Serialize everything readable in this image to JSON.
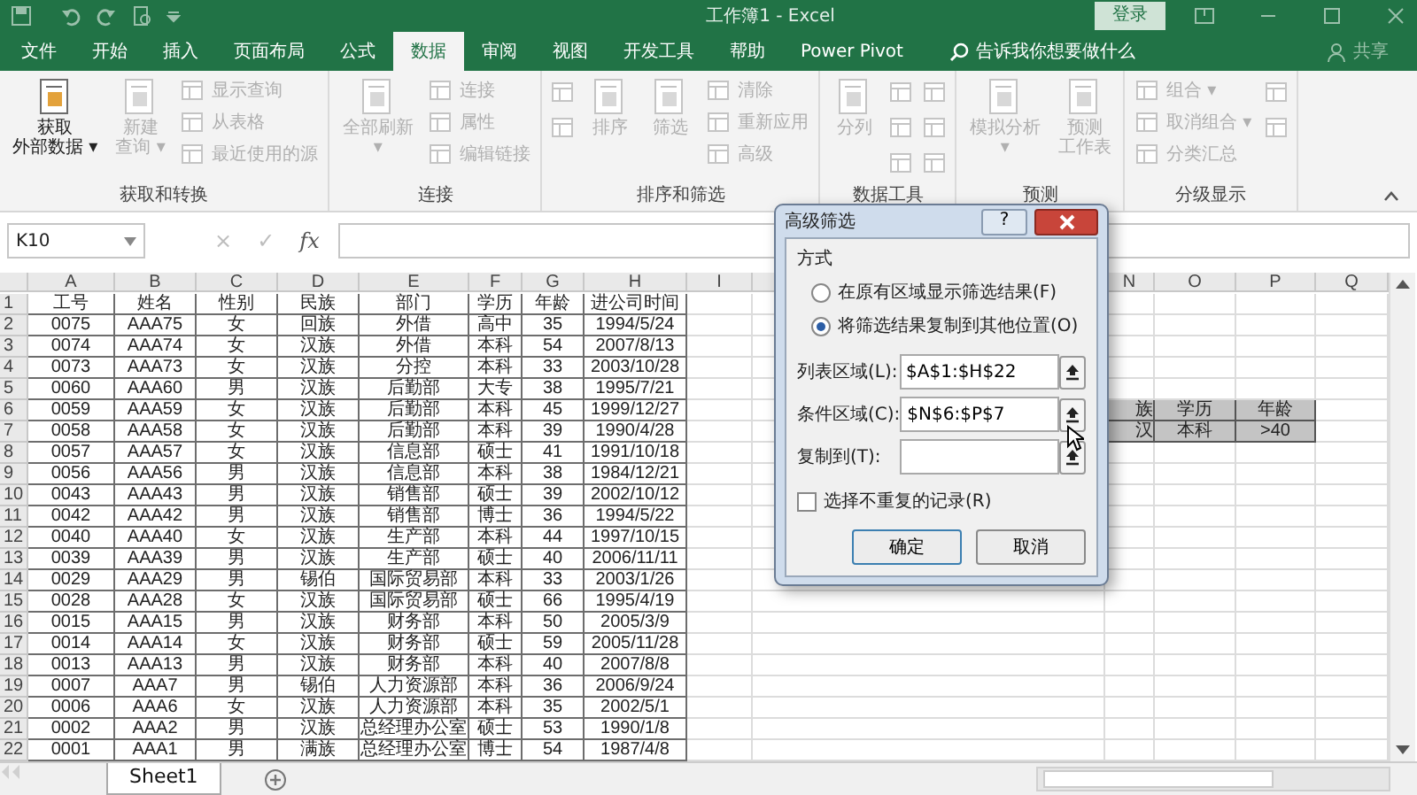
{
  "window": {
    "title": "工作簿1 - Excel",
    "login": "登录"
  },
  "tabs": [
    {
      "label": "文件",
      "selected": false
    },
    {
      "label": "开始",
      "selected": false
    },
    {
      "label": "插入",
      "selected": false
    },
    {
      "label": "页面布局",
      "selected": false
    },
    {
      "label": "公式",
      "selected": false
    },
    {
      "label": "数据",
      "selected": true
    },
    {
      "label": "审阅",
      "selected": false
    },
    {
      "label": "视图",
      "selected": false
    },
    {
      "label": "开发工具",
      "selected": false
    },
    {
      "label": "帮助",
      "selected": false
    },
    {
      "label": "Power Pivot",
      "selected": false
    }
  ],
  "tell_me": {
    "placeholder": "告诉我你想要做什么"
  },
  "share": "共享",
  "ribbon": [
    {
      "label": "获取和转换",
      "items": [
        {
          "kind": "large",
          "lines": [
            "获取",
            "外部数据 ▾"
          ],
          "disabled": false
        },
        {
          "kind": "large",
          "lines": [
            "新建",
            "查询 ▾"
          ],
          "disabled": true
        },
        {
          "kind": "small",
          "label": "显示查询",
          "disabled": true
        },
        {
          "kind": "small",
          "label": "从表格",
          "disabled": true
        },
        {
          "kind": "small",
          "label": "最近使用的源",
          "disabled": true
        }
      ]
    },
    {
      "label": "连接",
      "items": [
        {
          "kind": "large",
          "lines": [
            "全部刷新",
            "▾"
          ],
          "disabled": true
        },
        {
          "kind": "small",
          "label": "连接",
          "disabled": true
        },
        {
          "kind": "small",
          "label": "属性",
          "disabled": true
        },
        {
          "kind": "small",
          "label": "编辑链接",
          "disabled": true
        }
      ]
    },
    {
      "label": "排序和筛选",
      "items": [
        {
          "kind": "icon",
          "disabled": true
        },
        {
          "kind": "icon",
          "disabled": true
        },
        {
          "kind": "large",
          "lines": [
            "排序"
          ],
          "disabled": true
        },
        {
          "kind": "large",
          "lines": [
            "筛选"
          ],
          "disabled": true
        },
        {
          "kind": "small",
          "label": "清除",
          "disabled": true
        },
        {
          "kind": "small",
          "label": "重新应用",
          "disabled": true
        },
        {
          "kind": "small",
          "label": "高级",
          "disabled": true
        }
      ]
    },
    {
      "label": "数据工具",
      "items": [
        {
          "kind": "large",
          "lines": [
            "分列"
          ],
          "disabled": true
        },
        {
          "kind": "icon",
          "disabled": true
        },
        {
          "kind": "icon",
          "disabled": true
        },
        {
          "kind": "icon",
          "disabled": true
        },
        {
          "kind": "icon",
          "disabled": true
        },
        {
          "kind": "icon",
          "disabled": true
        },
        {
          "kind": "icon",
          "disabled": true
        }
      ]
    },
    {
      "label": "预测",
      "items": [
        {
          "kind": "large",
          "lines": [
            "模拟分析",
            "▾"
          ],
          "disabled": true
        },
        {
          "kind": "large",
          "lines": [
            "预测",
            "工作表"
          ],
          "disabled": true
        }
      ]
    },
    {
      "label": "分级显示",
      "items": [
        {
          "kind": "small",
          "label": "组合 ▾",
          "disabled": true
        },
        {
          "kind": "small",
          "label": "取消组合 ▾",
          "disabled": true
        },
        {
          "kind": "small",
          "label": "分类汇总",
          "disabled": true
        },
        {
          "kind": "icon",
          "disabled": true
        },
        {
          "kind": "icon",
          "disabled": true
        }
      ]
    }
  ],
  "formula_bar": {
    "name_box": "K10",
    "cancel": "×",
    "enter": "✓",
    "fx": "fx"
  },
  "sheet": {
    "columns": [
      "A",
      "B",
      "C",
      "D",
      "E",
      "F",
      "G",
      "H",
      "I",
      "N",
      "O",
      "P",
      "Q"
    ],
    "rows": [
      {
        "num": "1",
        "cells": [
          "工号",
          "姓名",
          "性别",
          "民族",
          "部门",
          "学历",
          "年龄",
          "进公司时间"
        ]
      },
      {
        "num": "2",
        "cells": [
          "0075",
          "AAA75",
          "女",
          "回族",
          "外借",
          "高中",
          "35",
          "1994/5/24"
        ]
      },
      {
        "num": "3",
        "cells": [
          "0074",
          "AAA74",
          "女",
          "汉族",
          "外借",
          "本科",
          "54",
          "2007/8/13"
        ]
      },
      {
        "num": "4",
        "cells": [
          "0073",
          "AAA73",
          "女",
          "汉族",
          "分控",
          "本科",
          "33",
          "2003/10/28"
        ]
      },
      {
        "num": "5",
        "cells": [
          "0060",
          "AAA60",
          "男",
          "汉族",
          "后勤部",
          "大专",
          "38",
          "1995/7/21"
        ]
      },
      {
        "num": "6",
        "cells": [
          "0059",
          "AAA59",
          "女",
          "汉族",
          "后勤部",
          "本科",
          "45",
          "1999/12/27"
        ],
        "criteria": {
          "highlighted": true,
          "cells": [
            "族",
            "学历",
            "年龄"
          ]
        }
      },
      {
        "num": "7",
        "cells": [
          "0058",
          "AAA58",
          "女",
          "汉族",
          "后勤部",
          "本科",
          "39",
          "1990/4/28"
        ],
        "criteria": {
          "highlighted": true,
          "cells": [
            "汉",
            "本科",
            ">40"
          ]
        }
      },
      {
        "num": "8",
        "cells": [
          "0057",
          "AAA57",
          "女",
          "汉族",
          "信息部",
          "硕士",
          "41",
          "1991/10/18"
        ]
      },
      {
        "num": "9",
        "cells": [
          "0056",
          "AAA56",
          "男",
          "汉族",
          "信息部",
          "本科",
          "38",
          "1984/12/21"
        ]
      },
      {
        "num": "10",
        "cells": [
          "0043",
          "AAA43",
          "男",
          "汉族",
          "销售部",
          "硕士",
          "39",
          "2002/10/12"
        ]
      },
      {
        "num": "11",
        "cells": [
          "0042",
          "AAA42",
          "男",
          "汉族",
          "销售部",
          "博士",
          "36",
          "1994/5/22"
        ]
      },
      {
        "num": "12",
        "cells": [
          "0040",
          "AAA40",
          "女",
          "汉族",
          "生产部",
          "本科",
          "44",
          "1997/10/15"
        ]
      },
      {
        "num": "13",
        "cells": [
          "0039",
          "AAA39",
          "男",
          "汉族",
          "生产部",
          "硕士",
          "40",
          "2006/11/11"
        ]
      },
      {
        "num": "14",
        "cells": [
          "0029",
          "AAA29",
          "男",
          "锡伯",
          "国际贸易部",
          "本科",
          "33",
          "2003/1/26"
        ]
      },
      {
        "num": "15",
        "cells": [
          "0028",
          "AAA28",
          "女",
          "汉族",
          "国际贸易部",
          "硕士",
          "66",
          "1995/4/19"
        ]
      },
      {
        "num": "16",
        "cells": [
          "0015",
          "AAA15",
          "男",
          "汉族",
          "财务部",
          "本科",
          "50",
          "2005/3/9"
        ]
      },
      {
        "num": "17",
        "cells": [
          "0014",
          "AAA14",
          "女",
          "汉族",
          "财务部",
          "硕士",
          "59",
          "2005/11/28"
        ]
      },
      {
        "num": "18",
        "cells": [
          "0013",
          "AAA13",
          "男",
          "汉族",
          "财务部",
          "本科",
          "40",
          "2007/8/8"
        ]
      },
      {
        "num": "19",
        "cells": [
          "0007",
          "AAA7",
          "男",
          "锡伯",
          "人力资源部",
          "本科",
          "36",
          "2006/9/24"
        ]
      },
      {
        "num": "20",
        "cells": [
          "0006",
          "AAA6",
          "女",
          "汉族",
          "人力资源部",
          "本科",
          "35",
          "2002/5/1"
        ]
      },
      {
        "num": "21",
        "cells": [
          "0002",
          "AAA2",
          "男",
          "汉族",
          "总经理办公室",
          "硕士",
          "53",
          "1990/1/8"
        ]
      },
      {
        "num": "22",
        "cells": [
          "0001",
          "AAA1",
          "男",
          "满族",
          "总经理办公室",
          "博士",
          "54",
          "1987/4/8"
        ]
      }
    ]
  },
  "sheet_tabs": [
    {
      "label": "Sheet1",
      "selected": true
    }
  ],
  "dialog": {
    "title": "高级筛选",
    "help": "?",
    "section": "方式",
    "options": [
      {
        "label": "在原有区域显示筛选结果(F)",
        "selected": false
      },
      {
        "label": "将筛选结果复制到其他位置(O)",
        "selected": true
      }
    ],
    "fields": [
      {
        "label": "列表区域(L):",
        "value": "$A$1:$H$22"
      },
      {
        "label": "条件区域(C):",
        "value": "$N$6:$P$7"
      },
      {
        "label": "复制到(T):"
      }
    ],
    "unique": {
      "label": "选择不重复的记录(R)",
      "checked": false
    },
    "buttons": [
      "确定",
      "取消"
    ]
  }
}
